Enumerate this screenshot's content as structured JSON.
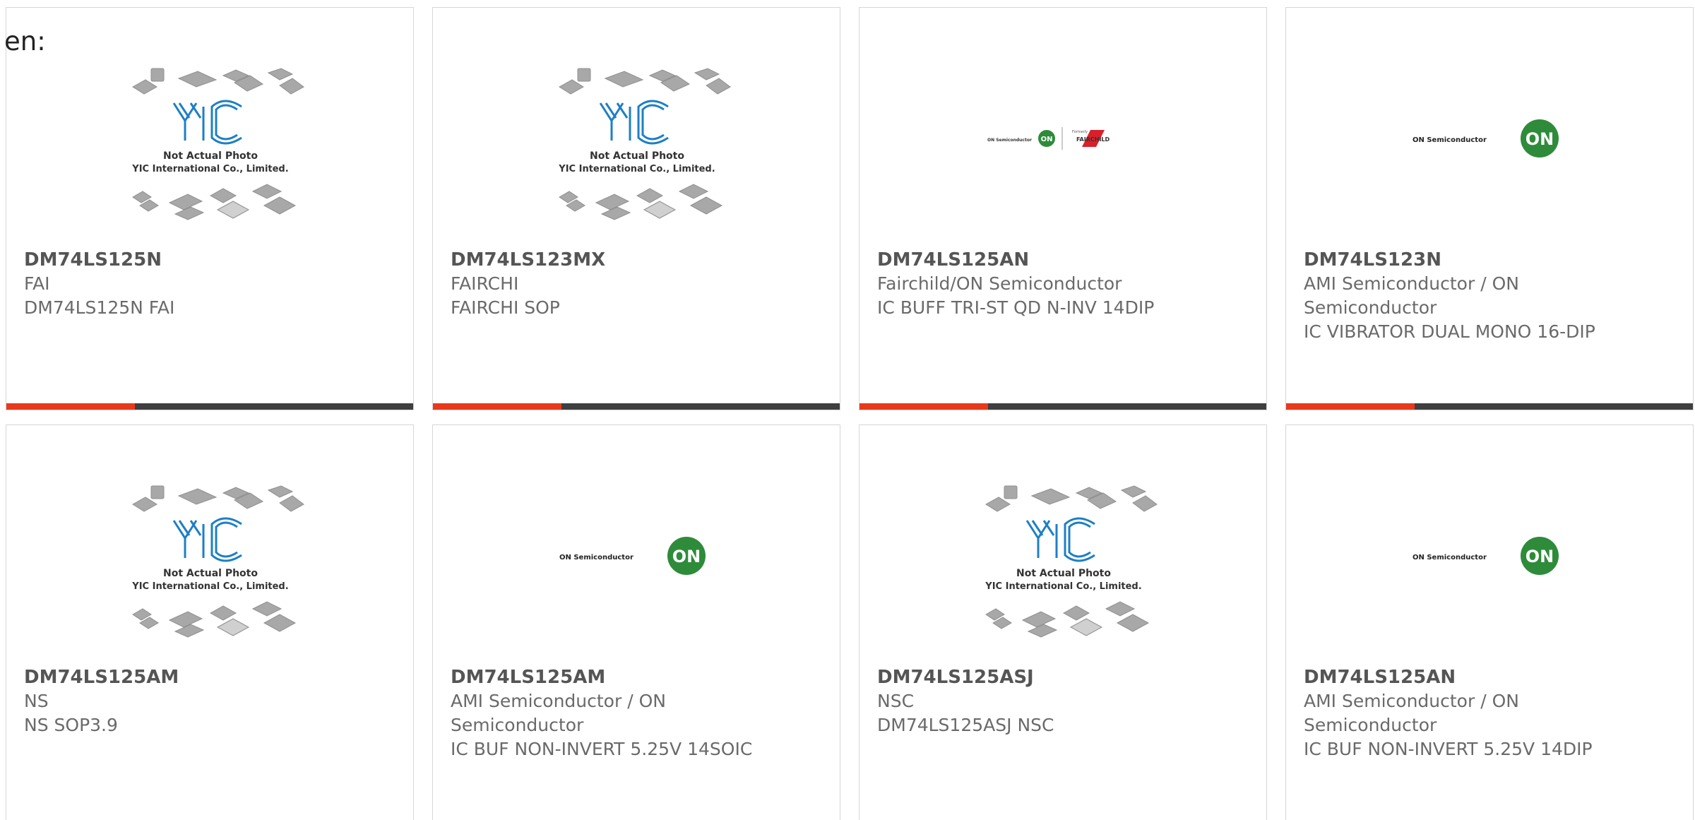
{
  "header": {
    "lang_label": "en:"
  },
  "logo_texts": {
    "yic_line1": "Not Actual Photo",
    "yic_line2": "YIC International Co., Limited.",
    "on_semi": "ON Semiconductor",
    "on_badge": "ON",
    "formerly": "Formerly",
    "fairchild": "FAIRCHILD"
  },
  "products": [
    {
      "part": "DM74LS125N",
      "manufacturer": "FAI",
      "description": "DM74LS125N FAI",
      "image": "yic-placeholder"
    },
    {
      "part": "DM74LS123MX",
      "manufacturer": "FAIRCHI",
      "description": "FAIRCHI SOP",
      "image": "yic-placeholder"
    },
    {
      "part": "DM74LS125AN",
      "manufacturer": "Fairchild/ON Semiconductor",
      "description": "IC BUFF TRI-ST QD N-INV 14DIP",
      "image": "on-fairchild-logo"
    },
    {
      "part": "DM74LS123N",
      "manufacturer": "AMI Semiconductor / ON Semiconductor",
      "description": "IC VIBRATOR DUAL MONO 16-DIP",
      "image": "on-semi-logo"
    },
    {
      "part": "DM74LS125AM",
      "manufacturer": "NS",
      "description": "NS SOP3.9",
      "image": "yic-placeholder"
    },
    {
      "part": "DM74LS125AM",
      "manufacturer": "AMI Semiconductor / ON Semiconductor",
      "description": "IC BUF NON-INVERT 5.25V 14SOIC",
      "image": "on-semi-logo"
    },
    {
      "part": "DM74LS125ASJ",
      "manufacturer": "NSC",
      "description": "DM74LS125ASJ NSC",
      "image": "yic-placeholder"
    },
    {
      "part": "DM74LS125AN",
      "manufacturer": "AMI Semiconductor / ON Semiconductor",
      "description": "IC BUF NON-INVERT 5.25V 14DIP",
      "image": "on-semi-logo"
    }
  ],
  "colors": {
    "accent_bar": "#e8391b",
    "dark_bar": "#3f3f3f",
    "yic_blue": "#1e7fc4",
    "on_green": "#2e8b3a",
    "fairchild_red": "#d8202a"
  }
}
